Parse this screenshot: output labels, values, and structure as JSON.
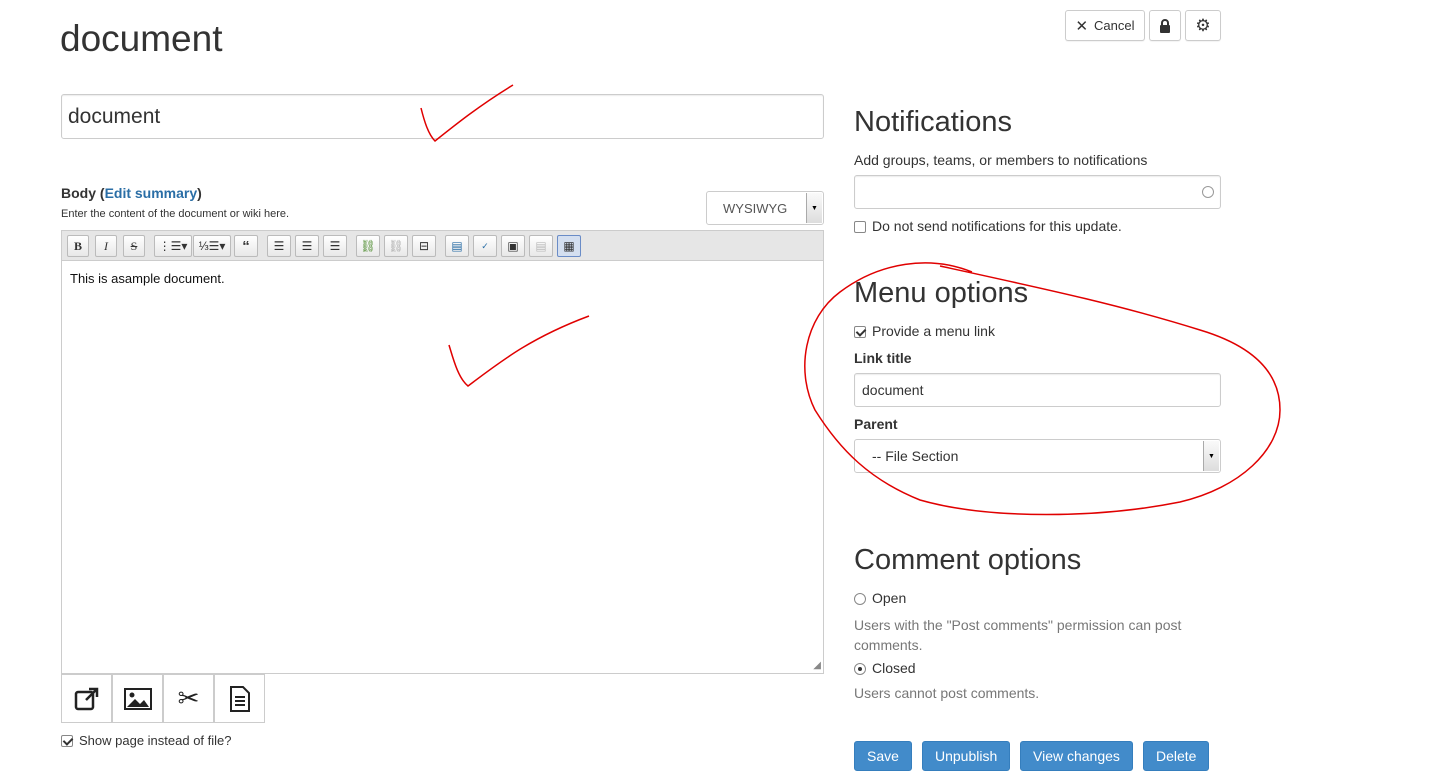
{
  "page": {
    "title": "document"
  },
  "top_actions": {
    "cancel_label": "Cancel",
    "cancel_icon": "close-icon",
    "lock_icon": "lock-icon",
    "settings_icon": "gear-icon"
  },
  "title_field": {
    "value": "document"
  },
  "body": {
    "label": "Body",
    "edit_summary_link": "Edit summary",
    "help": "Enter the content of the document or wiki here.",
    "text_format": "WYSIWYG",
    "content": "This is asample document.",
    "toolbar": [
      "bold",
      "italic",
      "strikethrough",
      "bullet-list",
      "numbered-list",
      "blockquote",
      "align-left",
      "align-center",
      "align-right",
      "link",
      "unlink",
      "page-break",
      "template",
      "spellcheck",
      "image",
      "paste-from-word",
      "show-blocks"
    ]
  },
  "media_buttons": [
    "external-link-icon",
    "image-icon",
    "scissors-icon",
    "document-icon"
  ],
  "show_page": {
    "label": "Show page instead of file?",
    "checked": true
  },
  "notifications": {
    "heading": "Notifications",
    "help": "Add groups, teams, or members to notifications",
    "input_value": "",
    "no_send_label": "Do not send notifications for this update.",
    "no_send_checked": false
  },
  "menu_options": {
    "heading": "Menu options",
    "provide_link_label": "Provide a menu link",
    "provide_link_checked": true,
    "link_title_label": "Link title",
    "link_title_value": "document",
    "parent_label": "Parent",
    "parent_value": "-- File Section"
  },
  "comment_options": {
    "heading": "Comment options",
    "open_label": "Open",
    "open_help": "Users with the \"Post comments\" permission can post comments.",
    "closed_label": "Closed",
    "closed_help": "Users cannot post comments.",
    "selected": "Closed"
  },
  "actions": {
    "save": "Save",
    "unpublish": "Unpublish",
    "view_changes": "View changes",
    "delete": "Delete"
  },
  "colors": {
    "primary_button": "#428bca",
    "link": "#2a6ea6",
    "annotation": "#e00000"
  }
}
